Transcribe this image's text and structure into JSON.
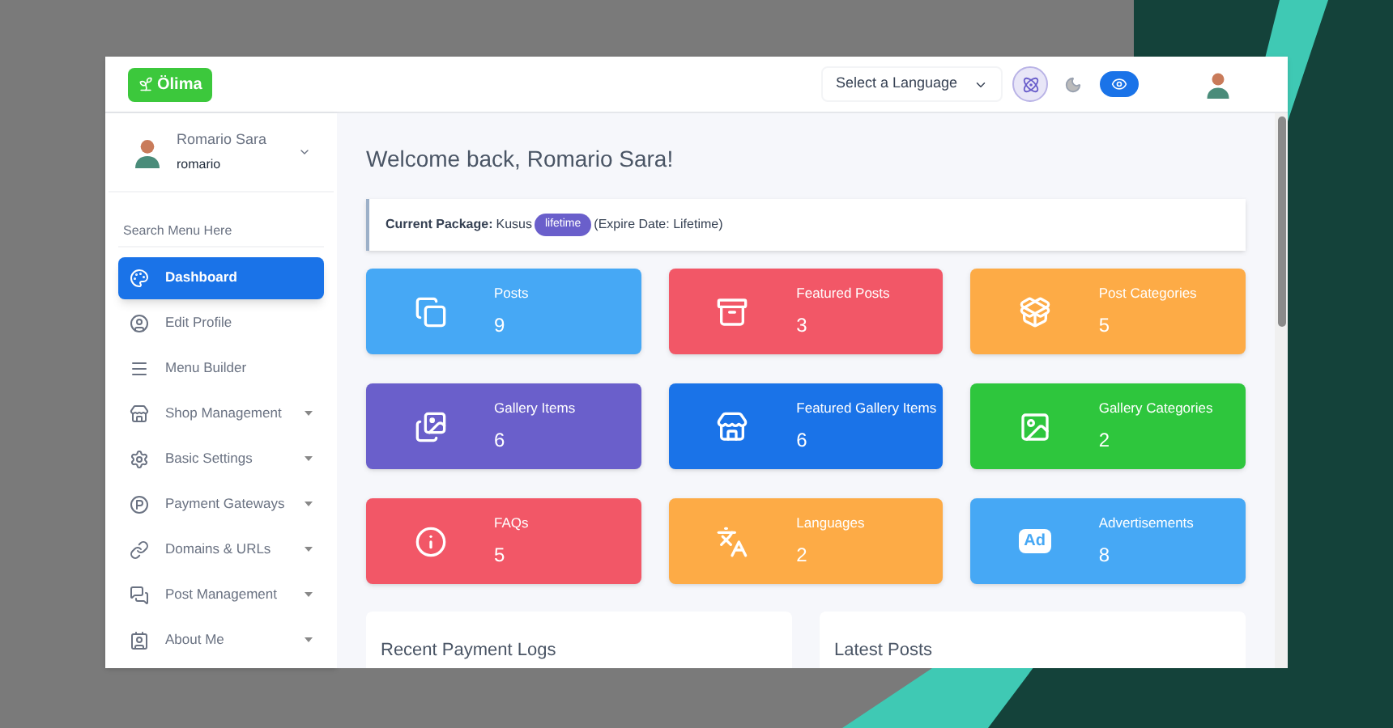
{
  "header": {
    "logo": "Ölima",
    "language_select": {
      "value": "Select a Language"
    }
  },
  "sidebar": {
    "user": {
      "name": "Romario Sara",
      "username": "romario"
    },
    "search": {
      "placeholder": "Search Menu Here"
    },
    "items": [
      {
        "label": "Dashboard",
        "selected": true,
        "expandable": false
      },
      {
        "label": "Edit Profile",
        "selected": false,
        "expandable": false
      },
      {
        "label": "Menu Builder",
        "selected": false,
        "expandable": false
      },
      {
        "label": "Shop Management",
        "selected": false,
        "expandable": true
      },
      {
        "label": "Basic Settings",
        "selected": false,
        "expandable": true
      },
      {
        "label": "Payment Gateways",
        "selected": false,
        "expandable": true
      },
      {
        "label": "Domains & URLs",
        "selected": false,
        "expandable": true
      },
      {
        "label": "Post Management",
        "selected": false,
        "expandable": true
      },
      {
        "label": "About Me",
        "selected": false,
        "expandable": true
      }
    ]
  },
  "main": {
    "title": "Welcome back, Romario Sara!",
    "package": {
      "label": "Current Package:",
      "name": "Kusus",
      "badge": "lifetime",
      "expire": "(Expire Date: Lifetime)"
    },
    "stats": [
      {
        "label": "Posts",
        "value": "9",
        "color": "#46a8f5"
      },
      {
        "label": "Featured Posts",
        "value": "3",
        "color": "#f25767"
      },
      {
        "label": "Post Categories",
        "value": "5",
        "color": "#fdab46"
      },
      {
        "label": "Gallery Items",
        "value": "6",
        "color": "#6a5fcb"
      },
      {
        "label": "Featured Gallery Items",
        "value": "6",
        "color": "#1a73e8"
      },
      {
        "label": "Gallery Categories",
        "value": "2",
        "color": "#2ec63d"
      },
      {
        "label": "FAQs",
        "value": "5",
        "color": "#f25767"
      },
      {
        "label": "Languages",
        "value": "2",
        "color": "#fdab46"
      },
      {
        "label": "Advertisements",
        "value": "8",
        "icon_text": "Ad",
        "color": "#46a8f5"
      }
    ],
    "panels": [
      {
        "title": "Recent Payment Logs"
      },
      {
        "title": "Latest Posts"
      }
    ]
  }
}
